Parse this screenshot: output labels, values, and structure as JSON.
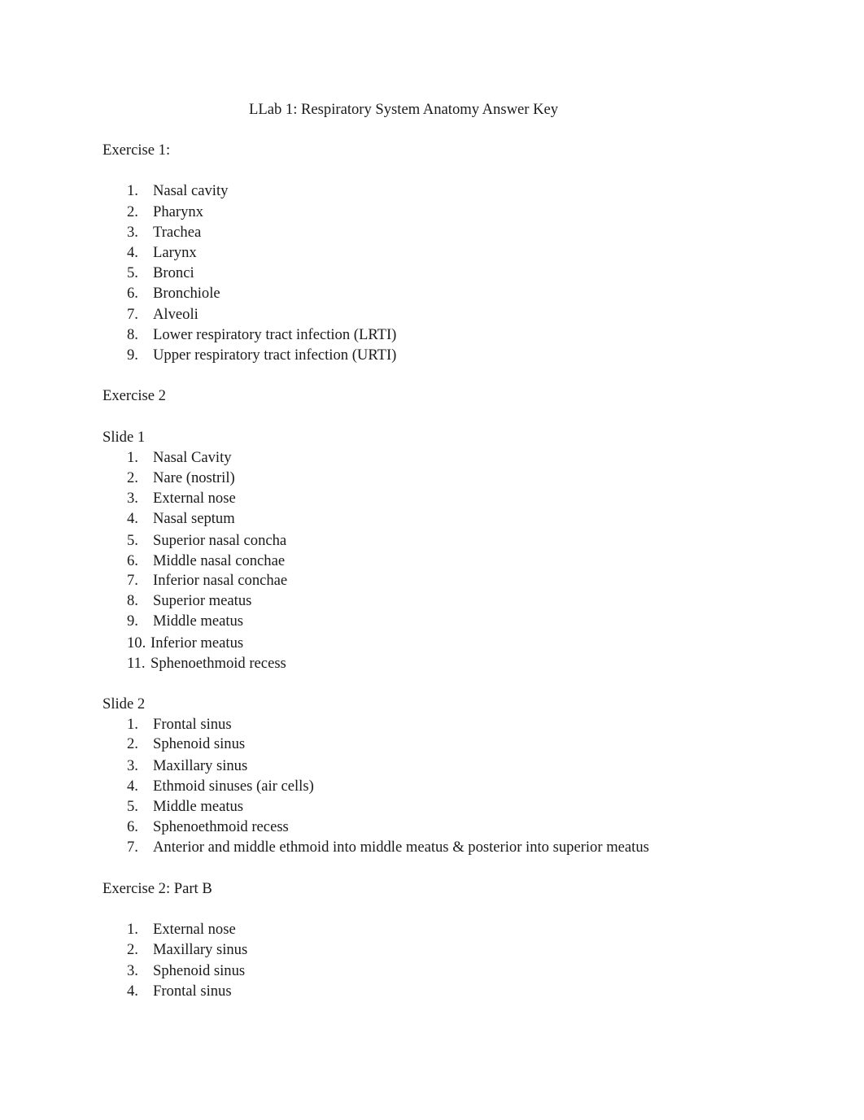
{
  "title": "LLab 1: Respiratory System Anatomy Answer Key",
  "sections": [
    {
      "heading": "Exercise 1:",
      "items": [
        {
          "n": "1.",
          "text": "Nasal cavity"
        },
        {
          "n": "2.",
          "text": "Pharynx"
        },
        {
          "n": "3.",
          "text": "Trachea"
        },
        {
          "n": "4.",
          "text": "Larynx"
        },
        {
          "n": "5.",
          "text": "Bronci"
        },
        {
          "n": "6.",
          "text": "Bronchiole"
        },
        {
          "n": "7.",
          "text": "Alveoli"
        },
        {
          "n": "8.",
          "text": "Lower respiratory tract infection (LRTI)"
        },
        {
          "n": "9.",
          "text": "Upper respiratory tract infection (URTI)"
        }
      ]
    },
    {
      "heading": "Exercise 2"
    },
    {
      "heading": "Slide 1",
      "items": [
        {
          "n": "1.",
          "text": "Nasal Cavity"
        },
        {
          "n": "2.",
          "text": "Nare (nostril)"
        },
        {
          "n": "3.",
          "text": "External nose"
        },
        {
          "n": "4.",
          "text": "Nasal septum"
        },
        {
          "n": "5.",
          "text": "Superior nasal concha"
        },
        {
          "n": "6.",
          "text": "Middle nasal conchae"
        },
        {
          "n": "7.",
          "text": "Inferior nasal conchae"
        },
        {
          "n": "8.",
          "text": "Superior meatus"
        },
        {
          "n": "9.",
          "text": "Middle meatus"
        },
        {
          "n": "10.",
          "text": "Inferior meatus"
        },
        {
          "n": "11.",
          "text": "Sphenoethmoid recess"
        }
      ]
    },
    {
      "heading": "Slide 2",
      "items": [
        {
          "n": "1.",
          "text": "Frontal sinus"
        },
        {
          "n": "2.",
          "text": "Sphenoid sinus"
        },
        {
          "n": "3.",
          "text": "Maxillary sinus"
        },
        {
          "n": "4.",
          "text": "Ethmoid sinuses (air cells)"
        },
        {
          "n": "5.",
          "text": "Middle meatus"
        },
        {
          "n": "6.",
          "text": "Sphenoethmoid recess"
        },
        {
          "n": "7.",
          "text": "Anterior and middle ethmoid into middle meatus & posterior into superior meatus"
        }
      ]
    },
    {
      "heading": "Exercise 2: Part B",
      "items": [
        {
          "n": "1.",
          "text": "External nose"
        },
        {
          "n": "2.",
          "text": "Maxillary sinus"
        },
        {
          "n": "3.",
          "text": "Sphenoid sinus"
        },
        {
          "n": "4.",
          "text": "Frontal sinus"
        }
      ]
    }
  ]
}
